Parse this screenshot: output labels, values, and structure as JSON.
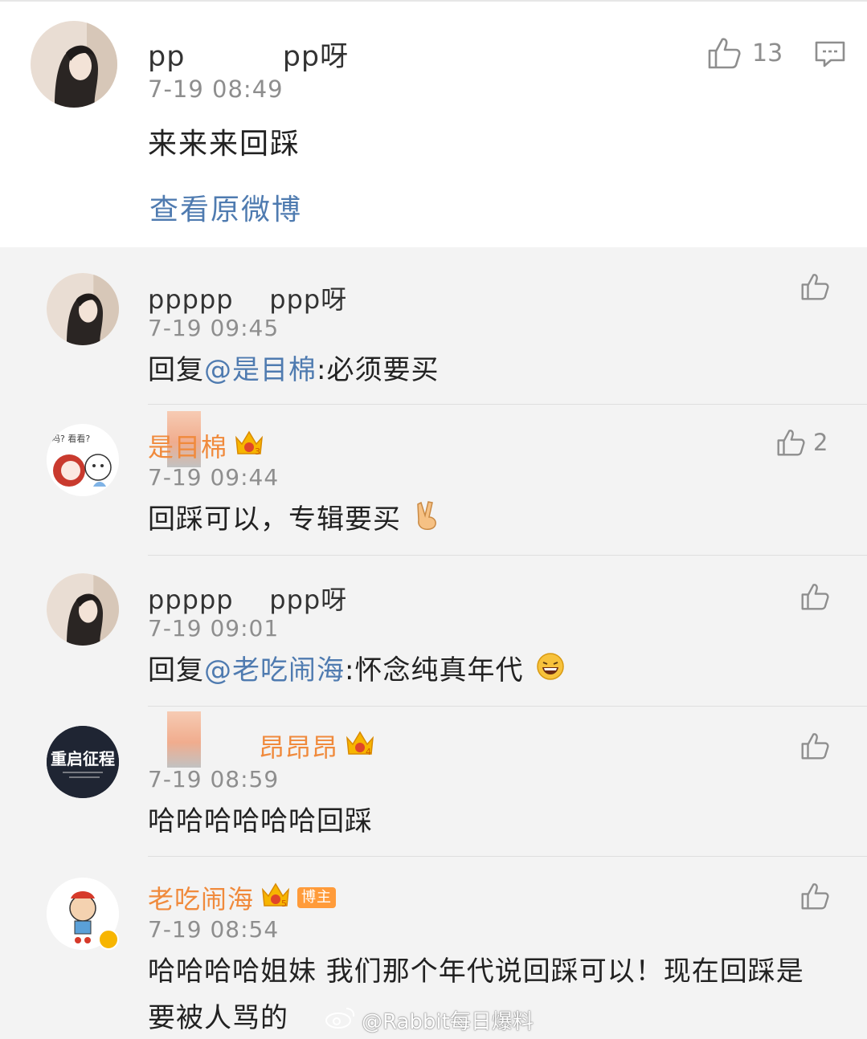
{
  "top_post": {
    "username": "pp          pp呀",
    "time": "7-19 08:49",
    "body": "来来来回踩",
    "view_original": "查看原微博",
    "like_count": "13"
  },
  "replies": [
    {
      "username": "ppppp    ppp呀",
      "time": "7-19 09:45",
      "text_prefix": "回复",
      "mention": "@是目棉",
      "text_suffix": ":必须要买",
      "like_count": ""
    },
    {
      "username": "是目棉",
      "time": "7-19 09:44",
      "text": "回踩可以，专辑要买",
      "like_count": "2",
      "crown_level": "3"
    },
    {
      "username": "ppppp    ppp呀",
      "time": "7-19 09:01",
      "text_prefix": "回复",
      "mention": "@老吃闹海",
      "text_suffix": ":怀念纯真年代",
      "like_count": ""
    },
    {
      "username": "昂昂昂",
      "time": "7-19 08:59",
      "text": "哈哈哈哈哈哈回踩",
      "like_count": "",
      "crown_level": "4",
      "avatar_text": "重启征程"
    },
    {
      "username": "老吃闹海",
      "time": "7-19 08:54",
      "text": "哈哈哈哈姐妹 我们那个年代说回踩可以！现在回踩是要被人骂的",
      "like_count": "",
      "crown_level": "5",
      "badge": "博主"
    }
  ],
  "watermark": "@Rabbit每日爆料",
  "colors": {
    "link": "#4f7bb0",
    "vip_name": "#f08a3c",
    "crown": "#f7b500",
    "page_bg": "#f3f3f3"
  },
  "icons": [
    "thumbs-up-icon",
    "comment-icon",
    "crown-icon",
    "weibo-logo-icon"
  ]
}
